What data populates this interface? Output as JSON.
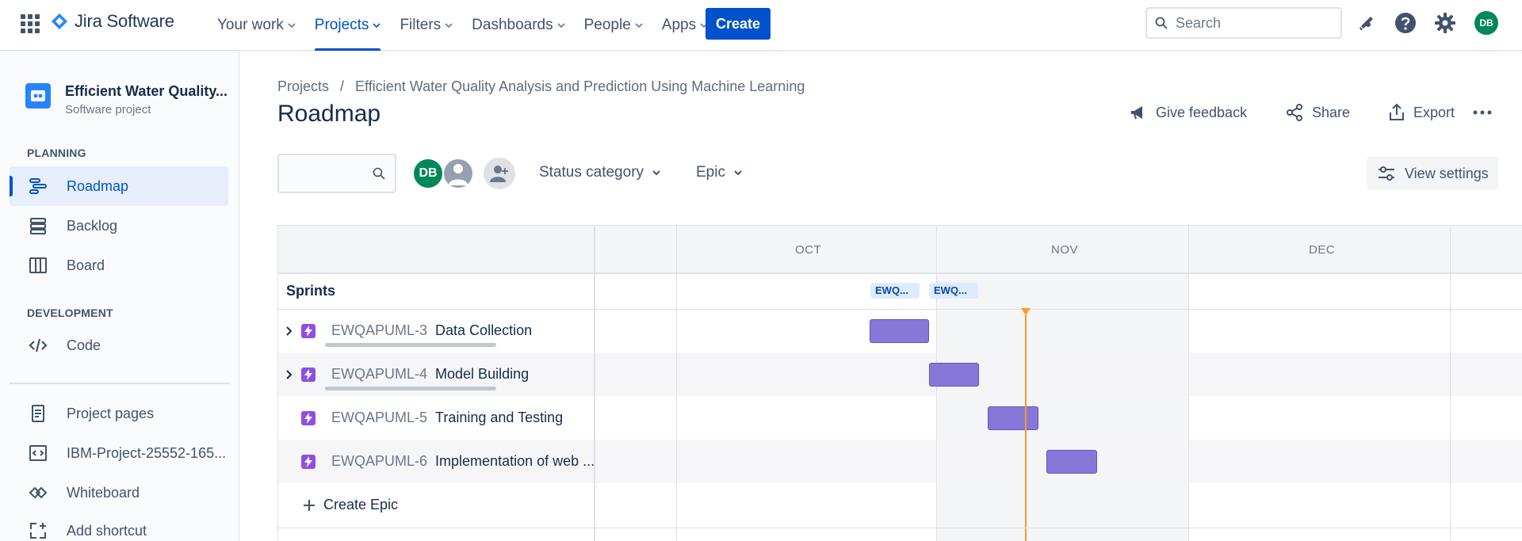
{
  "nav": {
    "brand": "Jira Software",
    "items": [
      {
        "label": "Your work",
        "active": false
      },
      {
        "label": "Projects",
        "active": true
      },
      {
        "label": "Filters",
        "active": false
      },
      {
        "label": "Dashboards",
        "active": false
      },
      {
        "label": "People",
        "active": false
      },
      {
        "label": "Apps",
        "active": false
      }
    ],
    "create_label": "Create",
    "search_placeholder": "Search",
    "user_initials": "DB"
  },
  "sidebar": {
    "project_name": "Efficient Water Quality...",
    "project_type": "Software project",
    "planning_label": "PLANNING",
    "development_label": "DEVELOPMENT",
    "items": [
      {
        "label": "Roadmap",
        "icon": "roadmap-icon",
        "active": true
      },
      {
        "label": "Backlog",
        "icon": "backlog-icon",
        "active": false
      },
      {
        "label": "Board",
        "icon": "board-icon",
        "active": false
      },
      {
        "label": "Code",
        "icon": "code-icon",
        "active": false
      },
      {
        "label": "Project pages",
        "icon": "page-icon",
        "active": false
      },
      {
        "label": "IBM-Project-25552-165...",
        "icon": "repo-icon",
        "active": false
      },
      {
        "label": "Whiteboard",
        "icon": "whiteboard-icon",
        "active": false
      },
      {
        "label": "Add shortcut",
        "icon": "add-shortcut-icon",
        "active": false
      }
    ]
  },
  "main": {
    "breadcrumb": {
      "root": "Projects",
      "separator": "/",
      "project": "Efficient Water Quality Analysis and Prediction Using Machine Learning"
    },
    "title": "Roadmap",
    "actions": {
      "feedback": "Give feedback",
      "share": "Share",
      "export": "Export"
    },
    "filters": {
      "avatar_initials": "DB",
      "status_category": "Status category",
      "epic": "Epic",
      "view_settings": "View settings"
    }
  },
  "roadmap": {
    "months": [
      "OCT",
      "NOV",
      "DEC"
    ],
    "sprints_label": "Sprints",
    "sprint_chips": [
      "EWQ...",
      "EWQ..."
    ],
    "epics": [
      {
        "key": "EWQAPUML-3",
        "summary": "Data Collection",
        "expandable": true,
        "has_progress": true
      },
      {
        "key": "EWQAPUML-4",
        "summary": "Model Building",
        "expandable": true,
        "has_progress": true
      },
      {
        "key": "EWQAPUML-5",
        "summary": "Training and Testing",
        "expandable": false,
        "has_progress": false
      },
      {
        "key": "EWQAPUML-6",
        "summary": "Implementation of web ...",
        "expandable": false,
        "has_progress": false
      }
    ],
    "create_epic_label": "Create Epic"
  },
  "colors": {
    "accent": "#0052cc",
    "epic": "#904ee2",
    "bar": "#8777d9",
    "today": "#ff991f",
    "avatar": "#00875a"
  }
}
